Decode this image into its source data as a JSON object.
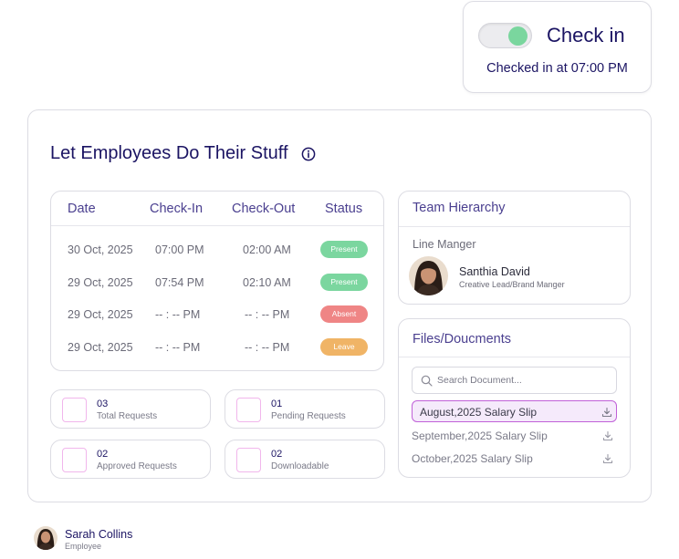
{
  "checkin": {
    "label": "Check in",
    "status": "Checked in at 07:00 PM",
    "toggle_on": true,
    "toggle_color": "#7ad69e"
  },
  "main": {
    "title": "Let Employees Do Their Stuff"
  },
  "attendance": {
    "headers": [
      "Date",
      "Check-In",
      "Check-Out",
      "Status"
    ],
    "rows": [
      {
        "date": "30 Oct, 2025",
        "check_in": "07:00 PM",
        "check_out": "02:00 AM",
        "status": "Present"
      },
      {
        "date": "29 Oct, 2025",
        "check_in": "07:54 PM",
        "check_out": "02:10 AM",
        "status": "Present"
      },
      {
        "date": "29 Oct, 2025",
        "check_in": "-- : -- PM",
        "check_out": "-- : -- PM",
        "status": "Absent"
      },
      {
        "date": "29 Oct, 2025",
        "check_in": "-- : -- PM",
        "check_out": "-- : -- PM",
        "status": "Leave"
      }
    ],
    "status_colors": {
      "Present": "#7bd69f",
      "Absent": "#ef8585",
      "Leave": "#f0b466"
    }
  },
  "stats": [
    {
      "count": "03",
      "label": "Total Requests"
    },
    {
      "count": "01",
      "label": "Pending Requests"
    },
    {
      "count": "02",
      "label": "Approved Requests"
    },
    {
      "count": "02",
      "label": "Downloadable"
    }
  ],
  "team": {
    "title": "Team Hierarchy",
    "line_manager_label": "Line Manger",
    "manager_name": "Santhia David",
    "manager_role": "Creative Lead/Brand Manger"
  },
  "files": {
    "title": "Files/Doucments",
    "search_placeholder": "Search Document...",
    "items": [
      {
        "name": "August,2025 Salary Slip",
        "selected": true
      },
      {
        "name": "September,2025 Salary Slip",
        "selected": false
      },
      {
        "name": "October,2025 Salary Slip",
        "selected": false
      }
    ]
  },
  "user": {
    "name": "Sarah Collins",
    "role": "Employee"
  }
}
